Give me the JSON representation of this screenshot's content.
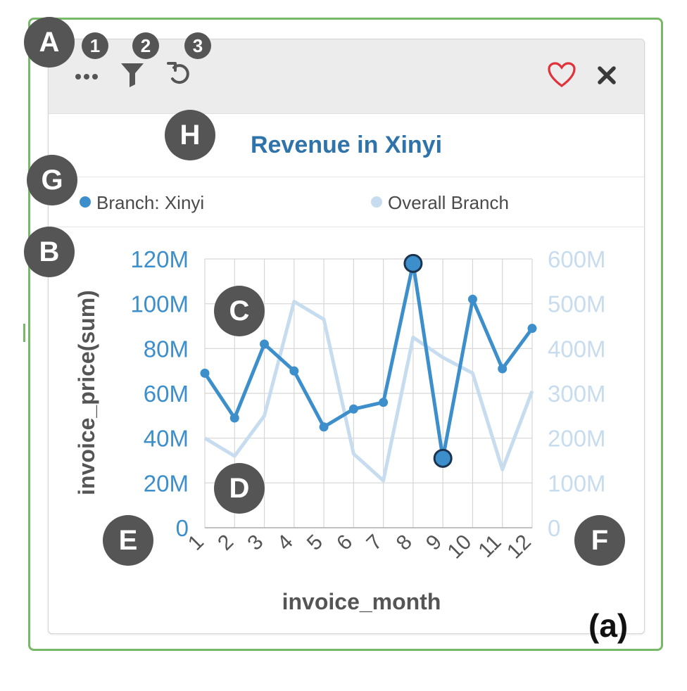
{
  "toolbar": {
    "icons": [
      "more-icon",
      "filter-icon",
      "undo-icon",
      "heart-icon",
      "close-icon"
    ],
    "heart_color": "#e0323a"
  },
  "chart_data": {
    "type": "line",
    "title": "Revenue in Xinyi",
    "xlabel": "invoice_month",
    "ylabel": "invoice_price(sum)",
    "categories": [
      "1",
      "2",
      "3",
      "4",
      "5",
      "6",
      "7",
      "8",
      "9",
      "10",
      "11",
      "12"
    ],
    "y_left": {
      "ylim": [
        0,
        120000000
      ],
      "ticks": [
        "0",
        "20M",
        "40M",
        "60M",
        "80M",
        "100M",
        "120M"
      ],
      "color": "#3d8fcc"
    },
    "y_right": {
      "ylim": [
        0,
        600000000
      ],
      "ticks": [
        "0",
        "100M",
        "200M",
        "300M",
        "400M",
        "500M",
        "600M"
      ],
      "color": "#c7dcee"
    },
    "series": [
      {
        "name": "Branch: Xinyi",
        "axis": "left",
        "color": "#3d8fcc",
        "values": [
          69000000,
          49000000,
          82000000,
          70000000,
          45000000,
          53000000,
          56000000,
          118000000,
          31000000,
          102000000,
          71000000,
          89000000
        ],
        "highlighted_months": [
          "8",
          "9"
        ]
      },
      {
        "name": "Overall Branch",
        "axis": "right",
        "color": "#c7dcee",
        "values": [
          200000000,
          160000000,
          250000000,
          505000000,
          465000000,
          165000000,
          105000000,
          425000000,
          380000000,
          345000000,
          130000000,
          305000000
        ]
      }
    ],
    "grid": true,
    "legend": "top"
  },
  "annotations": {
    "big": [
      "A",
      "B",
      "C",
      "D",
      "E",
      "F",
      "G",
      "H"
    ],
    "small": [
      "1",
      "2",
      "3"
    ],
    "panel_label": "(a)"
  }
}
